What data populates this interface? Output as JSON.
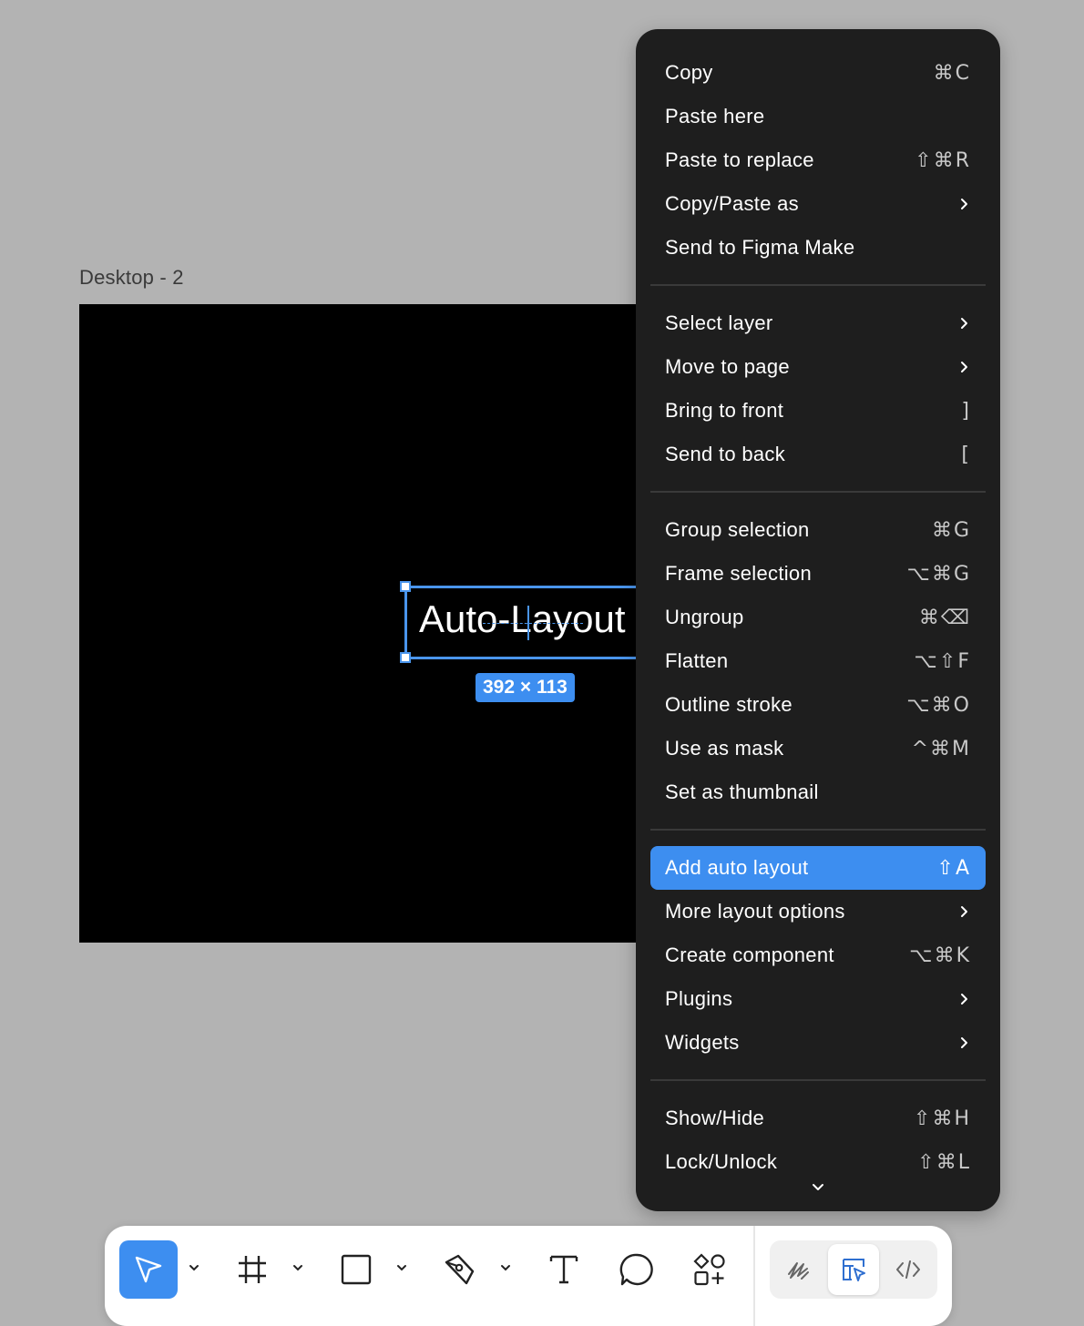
{
  "canvas": {
    "frame_label": "Desktop - 2",
    "selected_text": "Auto-Layout",
    "dimensions": "392 × 113"
  },
  "context_menu": {
    "groups": [
      [
        {
          "label": "Copy",
          "shortcut": "⌘C"
        },
        {
          "label": "Paste here",
          "shortcut": ""
        },
        {
          "label": "Paste to replace",
          "shortcut": "⇧⌘R"
        },
        {
          "label": "Copy/Paste as",
          "submenu": true
        },
        {
          "label": "Send to Figma Make",
          "shortcut": ""
        }
      ],
      [
        {
          "label": "Select layer",
          "submenu": true
        },
        {
          "label": "Move to page",
          "submenu": true
        },
        {
          "label": "Bring to front",
          "shortcut": "]"
        },
        {
          "label": "Send to back",
          "shortcut": "["
        }
      ],
      [
        {
          "label": "Group selection",
          "shortcut": "⌘G"
        },
        {
          "label": "Frame selection",
          "shortcut": "⌥⌘G"
        },
        {
          "label": "Ungroup",
          "shortcut": "⌘⌫"
        },
        {
          "label": "Flatten",
          "shortcut": "⌥⇧F"
        },
        {
          "label": "Outline stroke",
          "shortcut": "⌥⌘O"
        },
        {
          "label": "Use as mask",
          "shortcut": "^⌘M"
        },
        {
          "label": "Set as thumbnail",
          "shortcut": ""
        }
      ],
      [
        {
          "label": "Add auto layout",
          "shortcut": "⇧A",
          "highlighted": true
        },
        {
          "label": "More layout options",
          "submenu": true
        },
        {
          "label": "Create component",
          "shortcut": "⌥⌘K"
        },
        {
          "label": "Plugins",
          "submenu": true
        },
        {
          "label": "Widgets",
          "submenu": true
        }
      ],
      [
        {
          "label": "Show/Hide",
          "shortcut": "⇧⌘H"
        },
        {
          "label": "Lock/Unlock",
          "shortcut": "⇧⌘L"
        }
      ]
    ]
  },
  "toolbar": {
    "tools": [
      {
        "icon": "move-cursor-icon",
        "active": true
      },
      {
        "icon": "frame-icon"
      },
      {
        "icon": "rectangle-icon"
      },
      {
        "icon": "pen-icon"
      },
      {
        "icon": "text-icon"
      },
      {
        "icon": "comment-icon"
      },
      {
        "icon": "actions-icon"
      }
    ],
    "modes": [
      {
        "icon": "draw-mode-icon"
      },
      {
        "icon": "design-mode-icon",
        "active": true
      },
      {
        "icon": "dev-mode-icon"
      }
    ]
  },
  "colors": {
    "accent": "#3d8ef0",
    "menu_bg": "#1e1e1e",
    "canvas_bg": "#b3b3b3",
    "frame_bg": "#000000"
  }
}
